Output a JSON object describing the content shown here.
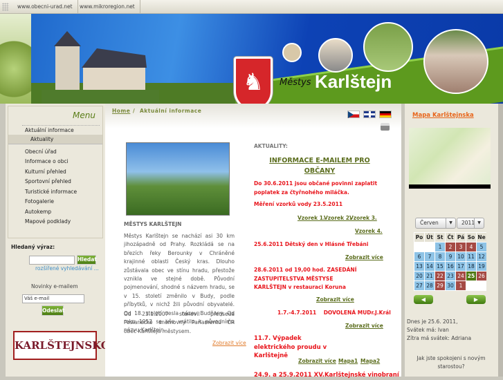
{
  "topbar": {
    "links": [
      "www.obecni-urad.net",
      "www.mikroregion.net"
    ]
  },
  "header": {
    "subtitle": "Městys",
    "title": "Karlštejn"
  },
  "menu": {
    "title": "Menu",
    "items": [
      "Aktuální informace",
      "Aktuality",
      "Obecní úřad",
      "Informace o obci",
      "Kulturní přehled",
      "Sportovní přehled",
      "Turistické informace",
      "Fotogalerie",
      "Autokemp",
      "Mapové podklady"
    ]
  },
  "search": {
    "label": "Hledaný výraz:",
    "value": "",
    "button": "Hledat",
    "advanced": "rozšířené vyhledávání ..."
  },
  "newsletter": {
    "label": "Novinky e-mailem",
    "value": "Váš e-mail",
    "button": "Odeslat"
  },
  "banner": {
    "text": "KARLŠTEJNSKO"
  },
  "breadcrumb": {
    "home": "Home",
    "sep": "/",
    "current": "Aktuální informace"
  },
  "article": {
    "heading": "MĚSTYS KARLŠTEJN",
    "p1": "Městys Karlštejn se nachází asi 30 km jihozápadně od Prahy. Rozkládá se na březích řeky Berounky v Chráněné krajinné oblasti Český kras. Dlouho zůstávala obec ve stínu hradu, přestože vznikla ve stejné době. Původní pojmenování, shodné s názvem hradu, se v 15. století změnilo v Budy, podle příbytků, v nichž žili původní obyvatelé. Od 18. století nesla název Budňany. Od roku 1952 se vše vrátilo k původnímu názvu Karlštejn.",
    "p2": "Od 23.1.2007 stanovil předseda Poslanecké sněmovny Parlamentu ČR obec Karlštejn městysem.",
    "more": "Zobrazit více"
  },
  "news": {
    "heading": "AKTUALITY:",
    "title": "INFORMACE E-MAILEM PRO OBČANY",
    "items": [
      "Do 30.6.2011 jsou občané povinni zaplatit poplatek za čtyřnohého miláčka.",
      "Měření vzorků vody 23.5.2011",
      "25.6.2011 Dětský den v Hlásné Třebáni",
      "28.6.2011 od 19,00 hod. ZASEDÁNÍ ZASTUPITELSTVA MĚSTYSE  KARLŠTEJN v restauraci Koruna",
      "1.7.-4.7.2011    DOVOLENÁ MUDr.J.Král",
      "11.7. Výpadek elektrického proudu v Karlštejně",
      "24.9. a 25.9.2011 XV.Karlštejnské vinobraní"
    ],
    "links": [
      "Vzorek 1.",
      "Vzorek 2.",
      "Vzorek 3.",
      "Vzorek 4.",
      "Zobrazit více",
      "Mapa1",
      "Mapa2"
    ]
  },
  "right": {
    "map_title": "Mapa Karlštejnska",
    "month": "Červen",
    "year": "2011",
    "weekdays": [
      "Po",
      "Út",
      "St",
      "Čt",
      "Pá",
      "So",
      "Ne"
    ],
    "today": "Dnes je 25.6. 2011,",
    "nameday": "Svátek má: Ivan",
    "tomorrow": "Zítra má svátek: Adriana",
    "poll": "Jak jste spokojeni s novým starostou?"
  },
  "calendar": {
    "offset": 2,
    "days": [
      1,
      2,
      3,
      4,
      5,
      6,
      7,
      8,
      9,
      10,
      11,
      12,
      13,
      14,
      15,
      16,
      17,
      18,
      19,
      20,
      21,
      22,
      23,
      24,
      25,
      26,
      27,
      28,
      29,
      30,
      1
    ],
    "event_days": [
      2,
      3,
      4,
      22,
      24,
      26,
      29
    ],
    "today": 25,
    "next_month_days": 1
  },
  "colors": {
    "accent": "#5b6d1d",
    "red": "#e8141b",
    "weekday": "#8ec3e6",
    "event": "#a54a44",
    "today": "#4f7a12"
  }
}
